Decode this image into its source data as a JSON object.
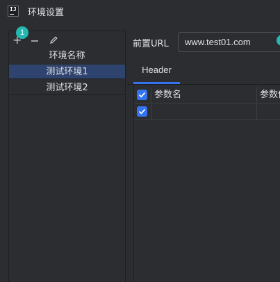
{
  "window": {
    "title": "环境设置",
    "app_icon_text": "IJ"
  },
  "toolbar": {
    "add_icon": "plus-icon",
    "remove_icon": "minus-icon",
    "edit_icon": "pencil-icon",
    "badge": "1"
  },
  "env_list": {
    "header": "环境名称",
    "items": [
      {
        "label": "测试环境1",
        "selected": true
      },
      {
        "label": "测试环境2",
        "selected": false
      }
    ]
  },
  "form": {
    "url_label": "前置URL",
    "url_value": "www.test01.com"
  },
  "tabs": [
    {
      "label": "Header",
      "active": true
    }
  ],
  "table": {
    "columns": [
      "参数名",
      "参数值"
    ],
    "header_checked": true,
    "rows": [
      {
        "checked": true,
        "name": "",
        "value": ""
      }
    ]
  },
  "colors": {
    "accent": "#3574f0",
    "selection": "#2e436e",
    "badge": "#25b8b0",
    "background": "#2b2d30"
  }
}
